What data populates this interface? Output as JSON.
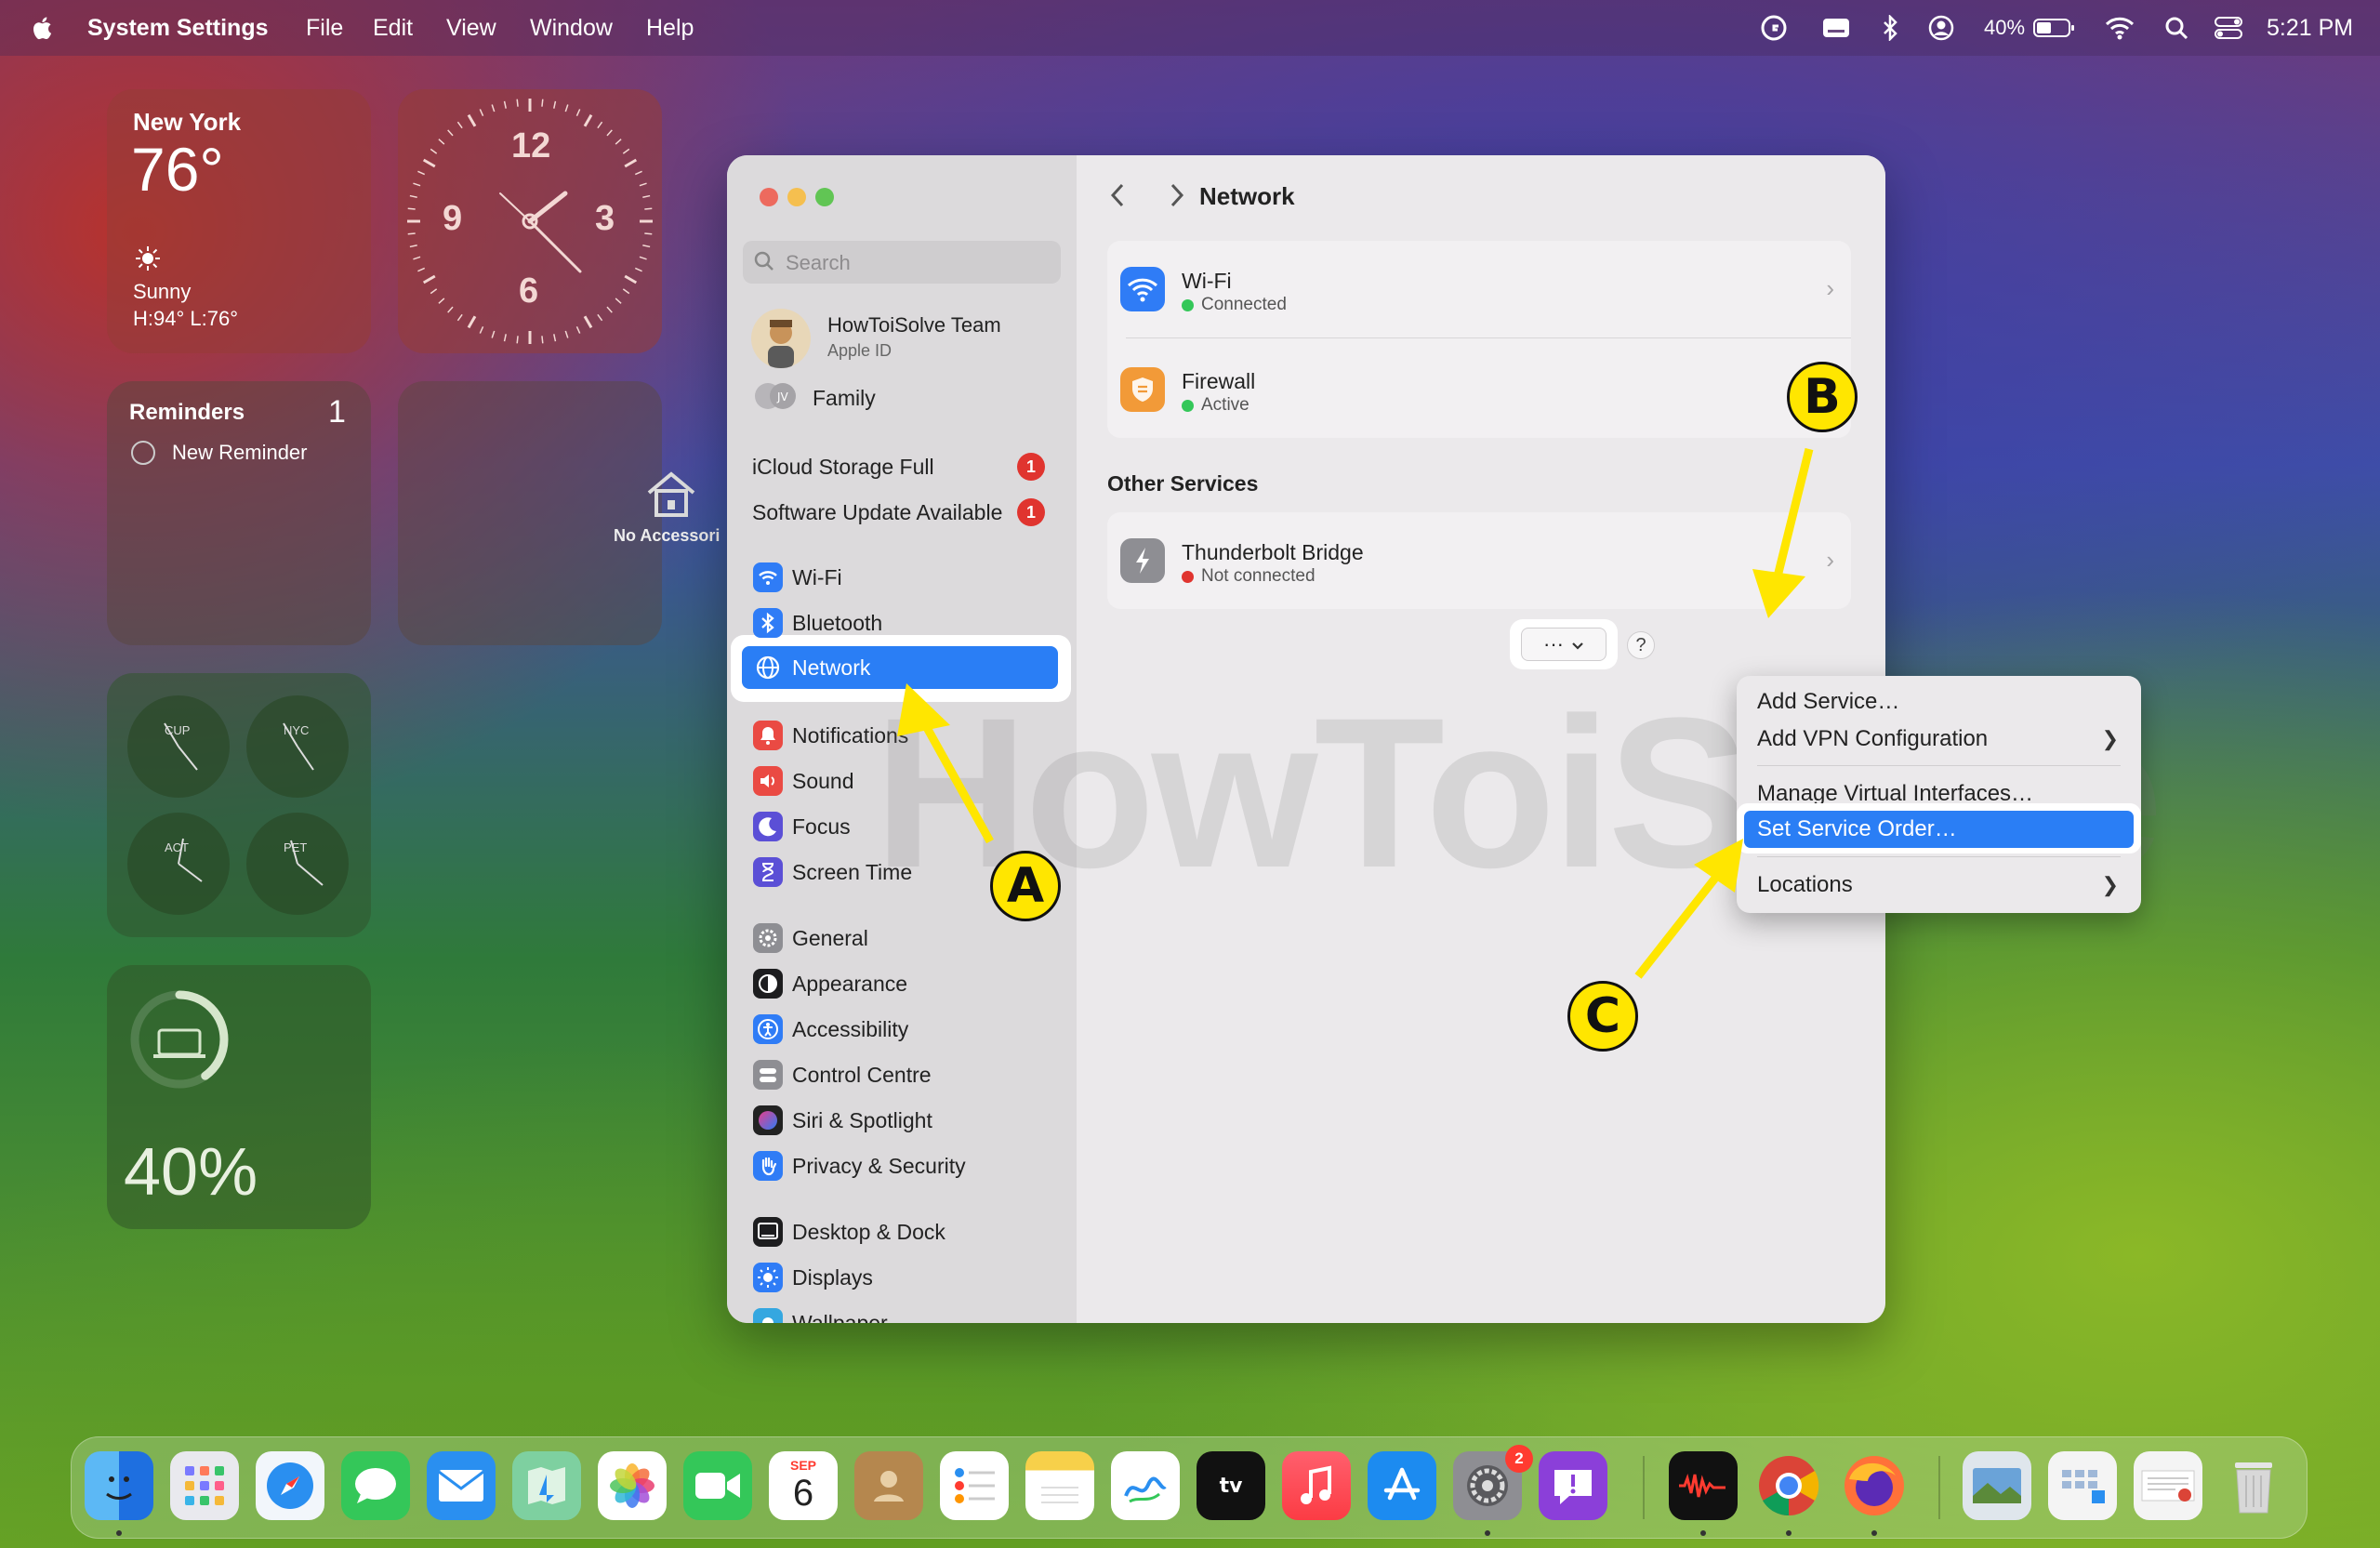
{
  "menubar": {
    "app_name": "System Settings",
    "menus": [
      "File",
      "Edit",
      "View",
      "Window",
      "Help"
    ],
    "battery_percent": "40%",
    "time": "5:21 PM",
    "icons": [
      "apple-icon",
      "grammarly-icon",
      "keyboard-icon",
      "bluetooth-icon",
      "user-icon",
      "battery-icon",
      "wifi-icon",
      "spotlight-icon",
      "control-center-icon"
    ]
  },
  "widgets": {
    "weather": {
      "city": "New York",
      "temp": "76°",
      "condition": "Sunny",
      "hilo": "H:94° L:76°"
    },
    "clock": {
      "n12": "12",
      "n3": "3",
      "n6": "6",
      "n9": "9"
    },
    "reminders": {
      "title": "Reminders",
      "count": "1",
      "item": "New Reminder"
    },
    "home": {
      "label": "No Accessori"
    },
    "world_clocks": [
      "CUP",
      "NYC",
      "ACT",
      "PET"
    ],
    "battery": {
      "percent": "40%"
    }
  },
  "sidebar": {
    "search_placeholder": "Search",
    "account": {
      "name": "HowToiSolve Team",
      "sub": "Apple ID"
    },
    "family": "Family",
    "alerts": [
      {
        "label": "iCloud Storage Full",
        "badge": "1"
      },
      {
        "label": "Software Update Available",
        "badge": "1"
      }
    ],
    "items": [
      {
        "label": "Wi-Fi",
        "icon": "wifi-icon",
        "color": "#2f7cf6"
      },
      {
        "label": "Bluetooth",
        "icon": "bluetooth-icon",
        "color": "#2f7cf6"
      },
      {
        "label": "Network",
        "icon": "globe-icon",
        "color": "#2f7cf6"
      },
      {
        "label": "Notifications",
        "icon": "bell-icon",
        "color": "#ea4a43"
      },
      {
        "label": "Sound",
        "icon": "speaker-icon",
        "color": "#ea4a43"
      },
      {
        "label": "Focus",
        "icon": "moon-icon",
        "color": "#5b4fd6"
      },
      {
        "label": "Screen Time",
        "icon": "hourglass-icon",
        "color": "#5b4fd6"
      },
      {
        "label": "General",
        "icon": "gear-icon",
        "color": "#8e8e93"
      },
      {
        "label": "Appearance",
        "icon": "appearance-icon",
        "color": "#1d1d1f"
      },
      {
        "label": "Accessibility",
        "icon": "accessibility-icon",
        "color": "#2f7cf6"
      },
      {
        "label": "Control Centre",
        "icon": "control-centre-icon",
        "color": "#8e8e93"
      },
      {
        "label": "Siri & Spotlight",
        "icon": "siri-icon",
        "color": "#7c3aed"
      },
      {
        "label": "Privacy & Security",
        "icon": "hand-icon",
        "color": "#2f7cf6"
      },
      {
        "label": "Desktop & Dock",
        "icon": "dock-icon",
        "color": "#1d1d1f"
      },
      {
        "label": "Displays",
        "icon": "sun-icon",
        "color": "#2f7cf6"
      },
      {
        "label": "Wallpaper",
        "icon": "wallpaper-icon",
        "color": "#35a7e0"
      }
    ],
    "selected": "Network"
  },
  "content": {
    "title": "Network",
    "services": [
      {
        "name": "Wi-Fi",
        "status": "Connected",
        "status_color": "#34c759",
        "icon": "wifi-icon",
        "icon_color": "#2f7cf6"
      },
      {
        "name": "Firewall",
        "status": "Active",
        "status_color": "#34c759",
        "icon": "firewall-icon",
        "icon_color": "#f29a38"
      }
    ],
    "other_title": "Other Services",
    "other": [
      {
        "name": "Thunderbolt Bridge",
        "status": "Not connected",
        "status_color": "#e0342f",
        "icon": "thunderbolt-icon",
        "icon_color": "#8e8e93"
      }
    ],
    "more_button": "···",
    "help_button": "?"
  },
  "menu": {
    "items": [
      {
        "label": "Add Service…",
        "submenu": false
      },
      {
        "label": "Add VPN Configuration",
        "submenu": true
      },
      {
        "label": "Manage Virtual Interfaces…",
        "submenu": false
      },
      {
        "label": "Set Service Order…",
        "submenu": false,
        "highlighted": true
      },
      {
        "label": "Locations",
        "submenu": true
      }
    ]
  },
  "annotations": {
    "a": "A",
    "b": "B",
    "c": "C",
    "watermark": "HowToiSolve"
  },
  "dock": {
    "calendar_month": "SEP",
    "calendar_day": "6",
    "settings_badge": "2",
    "apps": [
      "finder-icon",
      "launchpad-icon",
      "safari-icon",
      "messages-icon",
      "mail-icon",
      "maps-icon",
      "photos-icon",
      "facetime-icon",
      "calendar-icon",
      "contacts-icon",
      "reminders-icon",
      "notes-icon",
      "freeform-icon",
      "apple-tv-icon",
      "music-icon",
      "app-store-icon",
      "system-settings-icon",
      "feedback-icon",
      "voice-memos-icon",
      "chrome-icon",
      "firefox-icon",
      "preview-icon",
      "folder-icon",
      "document-icon",
      "trash-icon"
    ]
  }
}
